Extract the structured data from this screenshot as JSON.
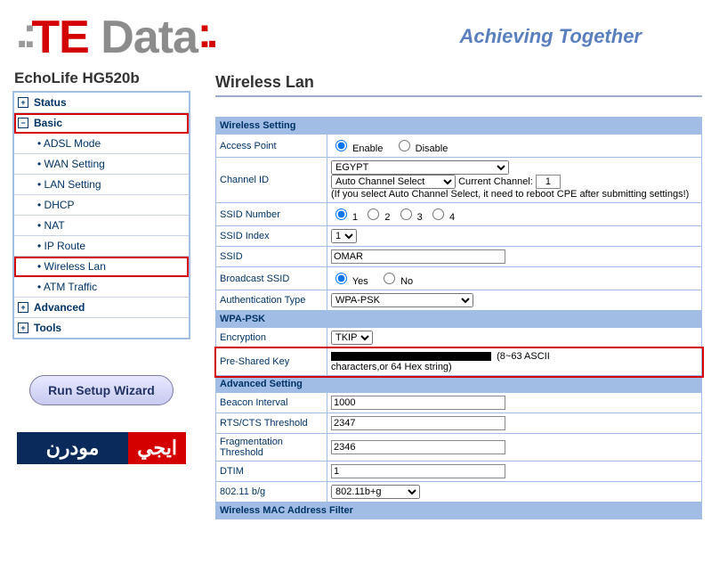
{
  "header": {
    "logo_te": "TE",
    "logo_data": " Data",
    "tagline": "Achieving Together"
  },
  "sidebar": {
    "device": "EchoLife HG520b",
    "top": [
      {
        "label": "Status",
        "icon": "+"
      },
      {
        "label": "Basic",
        "icon": "−",
        "highlight": true
      },
      {
        "label": "Advanced",
        "icon": "+"
      },
      {
        "label": "Tools",
        "icon": "+"
      }
    ],
    "basic_items": [
      "ADSL Mode",
      "WAN Setting",
      "LAN Setting",
      "DHCP",
      "NAT",
      "IP Route",
      "Wireless Lan",
      "ATM Traffic"
    ],
    "wizard": "Run Setup Wizard",
    "arabic_red": "ايجي",
    "arabic_blue": "مودرن"
  },
  "page": {
    "title": "Wireless Lan",
    "section_wireless": "Wireless Setting",
    "ap_label": "Access Point",
    "ap_enable": "Enable",
    "ap_disable": "Disable",
    "channel_label": "Channel ID",
    "country": "EGYPT",
    "channel_select": "Auto Channel Select",
    "cc_text": "Current Channel:",
    "cc_val": "1",
    "channel_note": "(If you select Auto Channel Select, it need to reboot CPE after submitting settings!)",
    "ssid_number": "SSID Number",
    "ssid_index": "SSID Index",
    "ssid_index_val": "1",
    "ssid_label": "SSID",
    "ssid_val": "OMAR",
    "bcast": "Broadcast SSID",
    "yes": "Yes",
    "no": "No",
    "auth_label": "Authentication Type",
    "auth_val": "WPA-PSK",
    "section_wpa": "WPA-PSK",
    "enc_label": "Encryption",
    "enc_val": "TKIP",
    "psk_label": "Pre-Shared Key",
    "psk_range": "(8~63 ASCII",
    "psk_note": "characters,or 64 Hex string)",
    "section_adv": "Advanced Setting",
    "beacon": "Beacon Interval",
    "beacon_v": "1000",
    "rts": "RTS/CTS Threshold",
    "rts_v": "2347",
    "frag": "Fragmentation Threshold",
    "frag_v": "2346",
    "dtim": "DTIM",
    "dtim_v": "1",
    "bg": "802.11 b/g",
    "bg_v": "802.11b+g",
    "section_mac": "Wireless MAC Address Filter"
  }
}
